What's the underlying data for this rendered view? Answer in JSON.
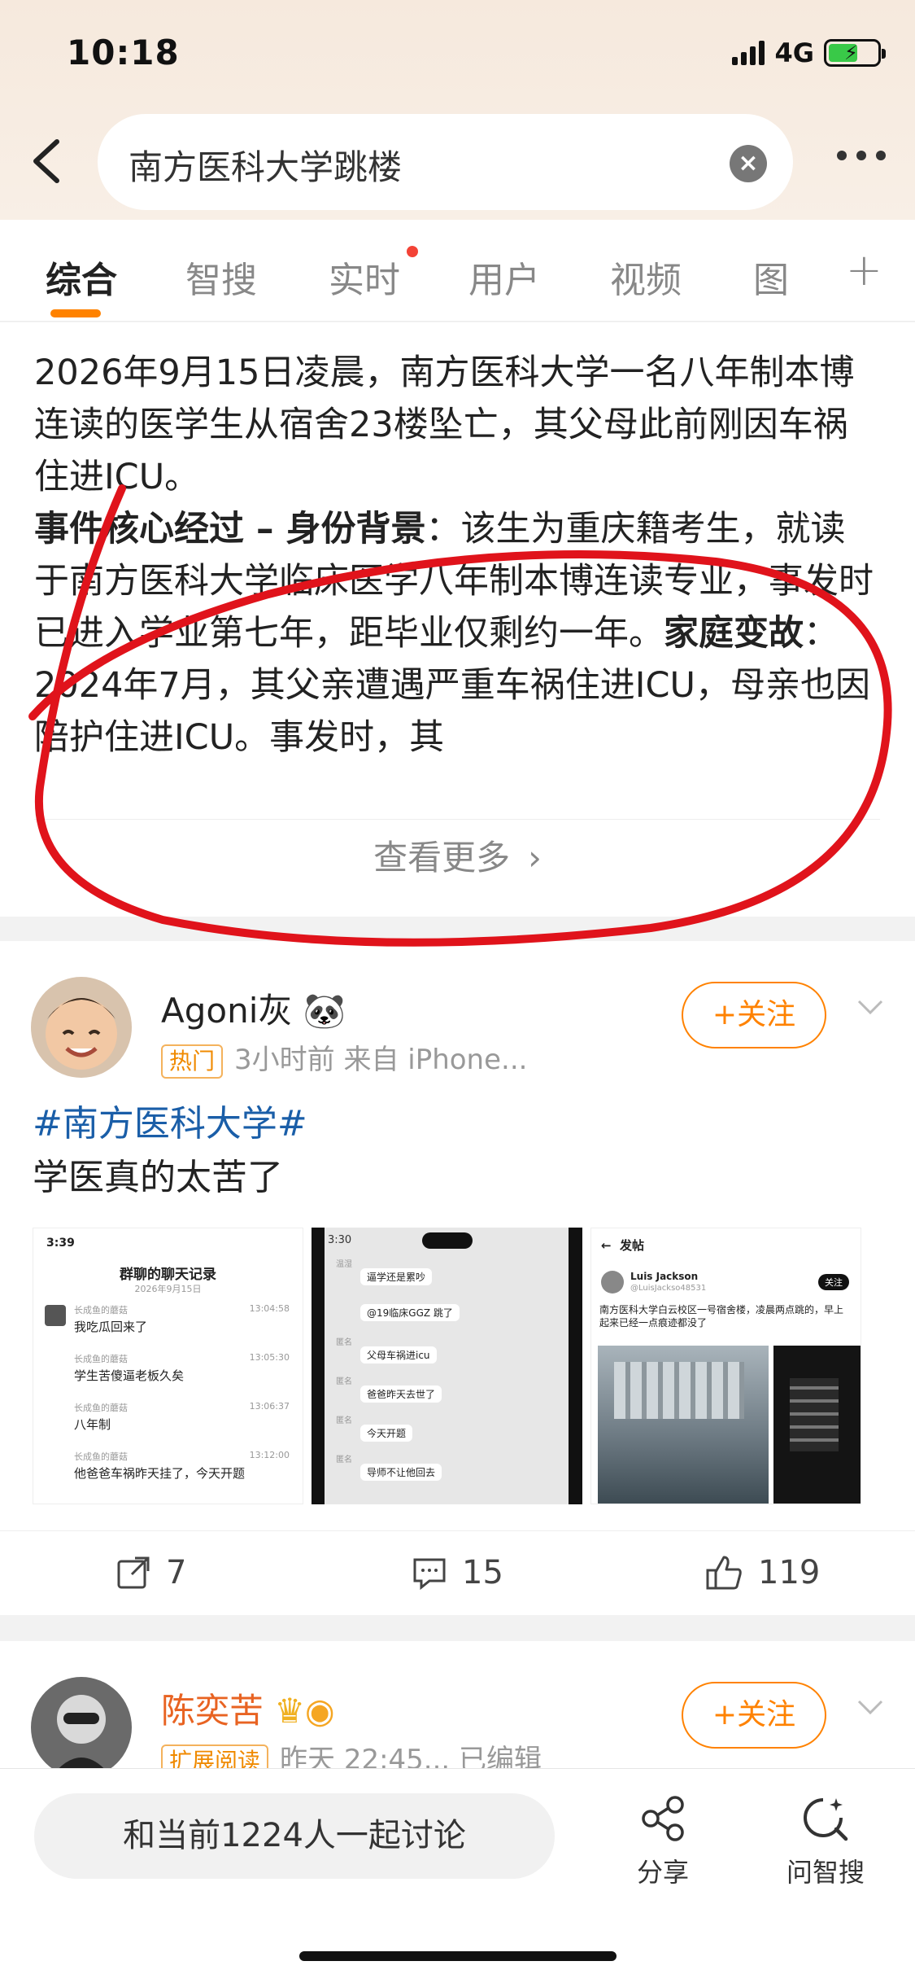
{
  "status_bar": {
    "time": "10:18",
    "network": "4G"
  },
  "search": {
    "query": "南方医科大学跳楼"
  },
  "tabs": [
    {
      "label": "综合"
    },
    {
      "label": "智搜"
    },
    {
      "label": "实时"
    },
    {
      "label": "用户"
    },
    {
      "label": "视频"
    },
    {
      "label": "图"
    }
  ],
  "summary": {
    "lines": [
      "2026年9月15日凌晨，南方医科大学一名八年制本博连读的医学生从宿舍23楼坠亡，其父母此前刚因车祸住进ICU。"
    ],
    "core_heading": "事件核心经过 – 身份背景",
    "core_text": "：该生为重庆籍考生，就读于南方医科大学临床医学八年制本博连读专业，事发时已进入学业第七年，距毕业仅剩约一年。",
    "family_heading": "家庭变故",
    "family_text": "：2024年7月，其父亲遭遇严重车祸住进ICU，母亲也因陪护住进ICU。事发时，其",
    "see_more": "查看更多"
  },
  "post1": {
    "author": "Agoni灰",
    "author_emoji": "🐼",
    "badge": "热门",
    "meta": "3小时前  来自 iPhone...",
    "follow": "+关注",
    "topic": "#南方医科大学#",
    "text": "学医真的太苦了",
    "thumb1": {
      "time": "3:39",
      "title": "群聊的聊天记录",
      "date": "2026年9月15日",
      "items": [
        {
          "name": "长成鱼的蘑菇",
          "time": "13:04:58",
          "msg": "我吃瓜回来了"
        },
        {
          "name": "长成鱼的蘑菇",
          "time": "13:05:30",
          "msg": "学生苦傻逼老板久矣"
        },
        {
          "name": "长成鱼的蘑菇",
          "time": "13:06:37",
          "msg": "八年制"
        },
        {
          "name": "长成鱼的蘑菇",
          "time": "13:12:00",
          "msg": "他爸爸车祸昨天挂了，今天开题"
        }
      ]
    },
    "thumb2": {
      "time": "3:30",
      "items": [
        {
          "name": "温湿",
          "msg": "逼学还是累吵"
        },
        {
          "name": "",
          "msg": "@19临床GGZ 跳了"
        },
        {
          "name": "匿名",
          "msg": "父母车祸进icu"
        },
        {
          "name": "匿名",
          "msg": "爸爸昨天去世了"
        },
        {
          "name": "匿名",
          "msg": "今天开题"
        },
        {
          "name": "匿名",
          "msg": "导师不让他回去"
        }
      ]
    },
    "thumb3": {
      "header": "发帖",
      "user": "Luis Jackson",
      "handle": "@LuisJackso48531",
      "follow": "关注",
      "text": "南方医科大学白云校区一号宿舍楼，凌晨两点跳的，早上起来已经一点痕迹都没了"
    },
    "share_count": "7",
    "comment_count": "15",
    "like_count": "119"
  },
  "post2": {
    "author": "陈奕苦",
    "badge": "扩展阅读",
    "meta": "昨天 22:45... 已编辑",
    "follow": "+关注"
  },
  "bottom_bar": {
    "discuss": "和当前1224人一起讨论",
    "share": "分享",
    "ask": "问智搜"
  },
  "colors": {
    "accent": "#ff8200",
    "topic": "#1a5ea8",
    "annotation": "#e0131b"
  }
}
